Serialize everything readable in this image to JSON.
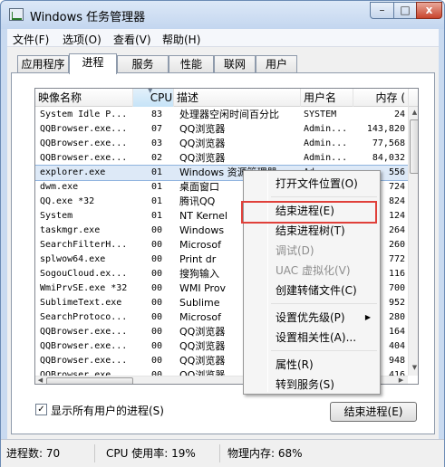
{
  "window": {
    "title": "Windows 任务管理器",
    "min": "–",
    "max": "□",
    "close": "x"
  },
  "menubar": [
    "文件(F)",
    "选项(O)",
    "查看(V)",
    "帮助(H)"
  ],
  "tabs": [
    "应用程序",
    "进程",
    "服务",
    "性能",
    "联网",
    "用户"
  ],
  "active_tab": 1,
  "columns": [
    "映像名称",
    "CPU",
    "描述",
    "用户名",
    "内存 ("
  ],
  "rows": [
    [
      "System Idle P...",
      "83",
      "处理器空闲时间百分比",
      "SYSTEM",
      "24"
    ],
    [
      "QQBrowser.exe...",
      "07",
      "QQ浏览器",
      "Admin...",
      "143,820"
    ],
    [
      "QQBrowser.exe...",
      "03",
      "QQ浏览器",
      "Admin...",
      "77,568"
    ],
    [
      "QQBrowser.exe...",
      "02",
      "QQ浏览器",
      "Admin...",
      "84,032"
    ],
    [
      "explorer.exe",
      "01",
      "Windows 资源管理器",
      "Ad",
      "556"
    ],
    [
      "dwm.exe",
      "01",
      "桌面窗口",
      "",
      "724"
    ],
    [
      "QQ.exe *32",
      "01",
      "腾讯QQ",
      "",
      "824"
    ],
    [
      "System",
      "01",
      "NT Kernel",
      "",
      "124"
    ],
    [
      "taskmgr.exe",
      "00",
      "Windows",
      "",
      "264"
    ],
    [
      "SearchFilterH...",
      "00",
      "Microsof",
      "",
      "260"
    ],
    [
      "splwow64.exe",
      "00",
      "Print dr",
      "",
      "772"
    ],
    [
      "SogouCloud.ex...",
      "00",
      "搜狗输入",
      "",
      "116"
    ],
    [
      "WmiPrvSE.exe *32",
      "00",
      "WMI Prov",
      "",
      "700"
    ],
    [
      "SublimeText.exe",
      "00",
      "Sublime",
      "",
      "952"
    ],
    [
      "SearchProtoco...",
      "00",
      "Microsof",
      "",
      "280"
    ],
    [
      "QQBrowser.exe...",
      "00",
      "QQ浏览器",
      "",
      "164"
    ],
    [
      "QQBrowser.exe...",
      "00",
      "QQ浏览器",
      "",
      "404"
    ],
    [
      "QQBrowser.exe...",
      "00",
      "QQ浏览器",
      "",
      "948"
    ],
    [
      "QQBrowser.exe",
      "00",
      "QQ浏览器",
      "",
      "416"
    ]
  ],
  "show_all_label": "显示所有用户的进程(S)",
  "end_process_button": "结束进程(E)",
  "status": {
    "procs": "进程数: 70",
    "cpu": "CPU 使用率: 19%",
    "mem": "物理内存: 68%"
  },
  "context_menu": [
    {
      "label": "打开文件位置(O)",
      "enabled": true
    },
    {
      "label": "结束进程(E)",
      "enabled": true,
      "highlighted": true
    },
    {
      "label": "结束进程树(T)",
      "enabled": true
    },
    {
      "label": "调试(D)",
      "enabled": false
    },
    {
      "label": "UAC 虚拟化(V)",
      "enabled": false
    },
    {
      "label": "创建转储文件(C)",
      "enabled": true
    },
    {
      "label": "设置优先级(P)",
      "enabled": true,
      "submenu": true
    },
    {
      "label": "设置相关性(A)...",
      "enabled": true
    },
    {
      "label": "属性(R)",
      "enabled": true
    },
    {
      "label": "转到服务(S)",
      "enabled": true
    }
  ],
  "highlight_color": "#e0403a"
}
